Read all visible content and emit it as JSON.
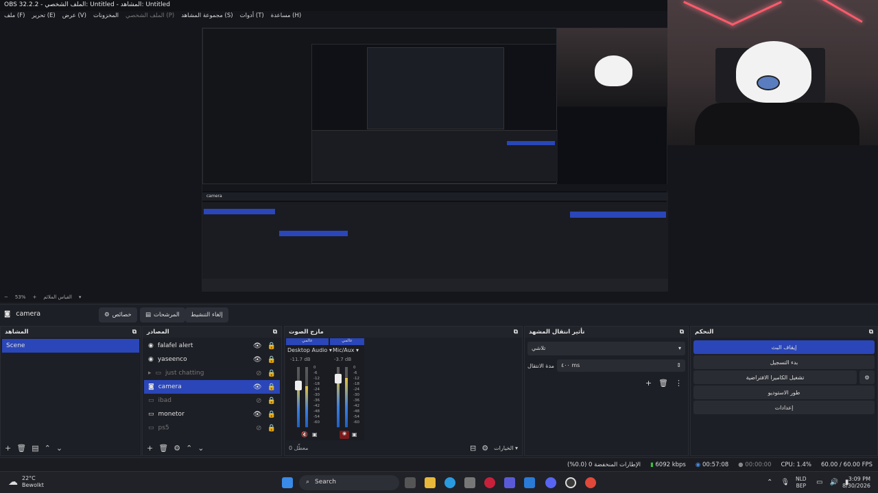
{
  "window": {
    "title": "OBS 32.2.2 - الملف الشخصي: Untitled - المشاهد: Untitled"
  },
  "menu": [
    "ملف (F)",
    "تحرير (E)",
    "عرض (V)",
    "المخزونات",
    "الملف الشخصي (P)",
    "مجموعة المشاهد (S)",
    "أدوات (T)",
    "مساعدة (H)"
  ],
  "zoom": {
    "minus": "−",
    "value": "53%",
    "plus": "+",
    "label": "القياس الملائم"
  },
  "toolbar": {
    "source_name": "camera",
    "properties": "خصائص",
    "filters": "المرشحات",
    "deactivate": "إلغاء التنشيط"
  },
  "docks": {
    "scenes": {
      "title": "المشاهد",
      "items": [
        {
          "label": "Scene",
          "selected": true
        }
      ]
    },
    "sources": {
      "title": "المصادر",
      "items": [
        {
          "label": "falafel alert",
          "icon": "globe-icon",
          "visible": true
        },
        {
          "label": "yaseenco",
          "icon": "globe-icon",
          "visible": true
        },
        {
          "label": "just chatting",
          "icon": "folder-icon",
          "visible": false
        },
        {
          "label": "camera",
          "icon": "camera-icon",
          "visible": true,
          "selected": true
        },
        {
          "label": "ibad",
          "icon": "window-icon",
          "visible": false
        },
        {
          "label": "monetor",
          "icon": "monitor-icon",
          "visible": true
        },
        {
          "label": "ps5",
          "icon": "window-icon",
          "visible": false
        }
      ]
    },
    "mixer": {
      "title": "مازج الصوت",
      "channels": [
        {
          "tag": "عالمي",
          "name": "Desktop Audio",
          "db": "-11.7 dB",
          "level": 0.72
        },
        {
          "tag": "عالمي",
          "name": "Mic/Aux",
          "db": "-3.7 dB",
          "level": 0.85
        }
      ],
      "ticks": [
        "0",
        "-6",
        "-12",
        "-18",
        "-24",
        "-30",
        "-36",
        "-42",
        "-48",
        "-54",
        "-60"
      ],
      "footer": "0 معطّل"
    },
    "transitions": {
      "title": "تأثير انتقال المشهد",
      "selected": "تلاشي",
      "duration_label": "مدة الانتقال",
      "duration_value": "٤٠٠ ms"
    },
    "controls": {
      "title": "التحكم",
      "buttons": [
        {
          "label": "إيقاف البث",
          "active": true
        },
        {
          "label": "بدء التسجيل"
        },
        {
          "label": "تشغيل الكاميرا الافتراضية"
        },
        {
          "label": "طور الاستوديو"
        },
        {
          "label": "إعدادات"
        }
      ]
    }
  },
  "mixer_footer": {
    "options": "الخيارات"
  },
  "status": {
    "dropped": "الإطارات المنخفضة 0 (0.0%)",
    "bitrate": "6092 kbps",
    "live_time": "00:57:08",
    "rec_time": "00:00:00",
    "cpu": "CPU: 1.4%",
    "fps": "60.00 / 60.00 FPS"
  },
  "taskbar": {
    "weather_temp": "22°C",
    "weather_desc": "Bewolkt",
    "search": "Search",
    "lang": "NLD",
    "lang2": "BEP",
    "time": "3:09 PM",
    "date": "8/30/2026"
  },
  "colors": {
    "accent": "#2a46b8",
    "background": "#1d1f26"
  }
}
